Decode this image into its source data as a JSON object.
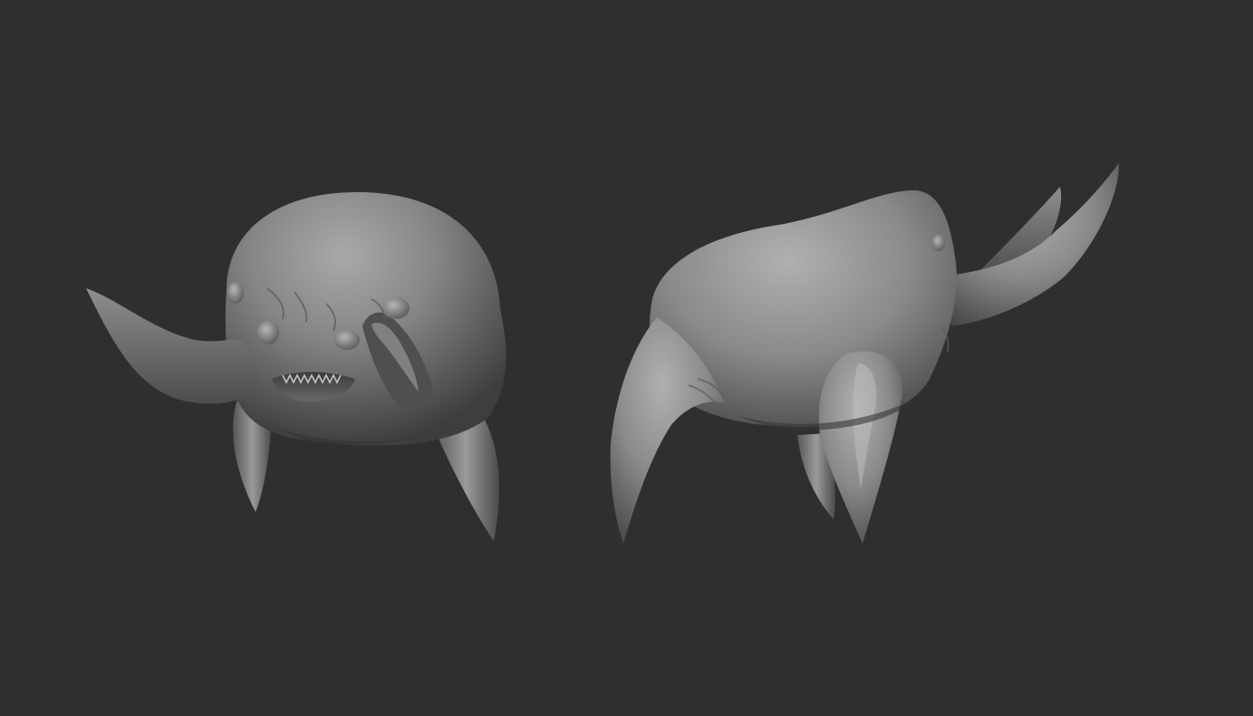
{
  "scene": {
    "background_color": "#2f2f2f",
    "material_light": "#a8a8a8",
    "material_mid": "#7a7a7a",
    "material_dark": "#3f3f3f",
    "models": [
      {
        "name": "creature-front-view"
      },
      {
        "name": "creature-side-view"
      }
    ]
  }
}
